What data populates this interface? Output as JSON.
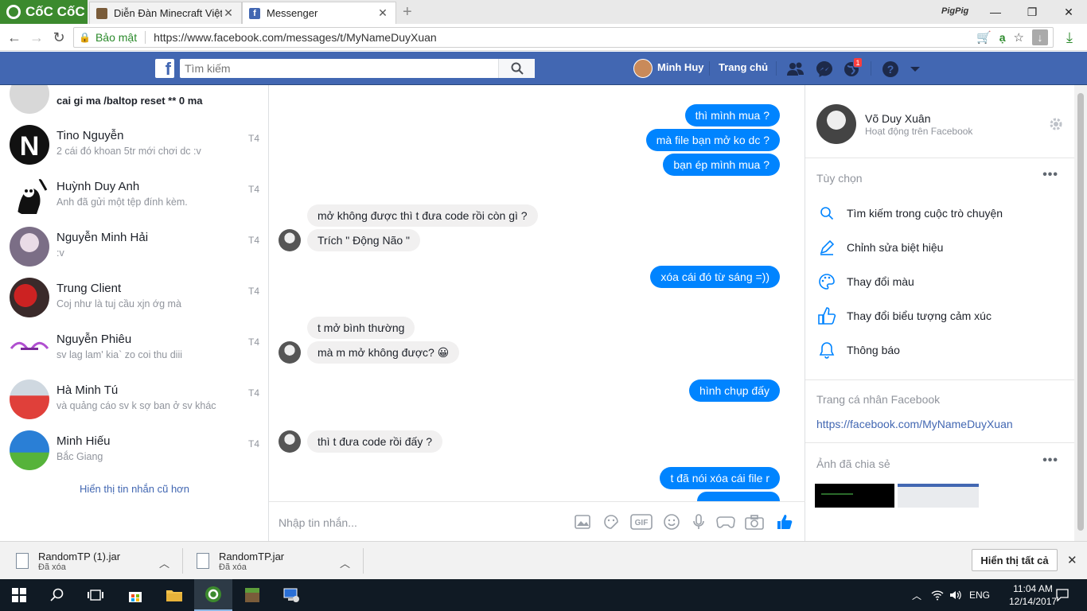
{
  "browser": {
    "brand": "CốC CốC",
    "tabs": [
      {
        "title": "Diễn Đàn Minecraft Việt N",
        "favicon": "minecraft-icon"
      },
      {
        "title": "Messenger",
        "favicon": "facebook-icon"
      }
    ],
    "profile": "PigPig",
    "security_label": "Bảo mật",
    "url": "https://www.facebook.com/messages/t/MyNameDuyXuan"
  },
  "fb": {
    "search_placeholder": "Tìm kiếm",
    "user": "Minh Huy",
    "home": "Trang chủ",
    "notif_count": "1"
  },
  "conversations": [
    {
      "name": "cai gi ma /baltop reset ** 0 ma",
      "snippet": "",
      "day": ""
    },
    {
      "name": "Tino Nguyễn",
      "snippet": "2 cái đó khoan 5tr mới chơi dc :v",
      "day": "T4"
    },
    {
      "name": "Huỳnh Duy Anh",
      "snippet": "Anh đã gửi một tệp đính kèm.",
      "day": "T4"
    },
    {
      "name": "Nguyễn Minh Hải",
      "snippet": ":v",
      "day": "T4"
    },
    {
      "name": "Trung Client",
      "snippet": "Coj như là tuj cầu xjn ớg mà",
      "day": "T4"
    },
    {
      "name": "Nguyễn Phiêu",
      "snippet": "sv lag lam' kia` zo coi thu diii",
      "day": "T4"
    },
    {
      "name": "Hà Minh Tú",
      "snippet": "và quảng cáo sv k sợ ban ở sv khác",
      "day": "T4"
    },
    {
      "name": "Minh Hiếu",
      "snippet": "Bắc Giang",
      "day": "T4"
    }
  ],
  "older_label": "Hiển thị tin nhắn cũ hơn",
  "messages": [
    {
      "text": "thì mình mua ?",
      "dir": "out"
    },
    {
      "text": "mà file bạn mở ko dc ?",
      "dir": "out"
    },
    {
      "text": "bạn ép mình mua ?",
      "dir": "out"
    },
    {
      "text": "mở không được thì t đưa code rồi còn gì ?",
      "dir": "in"
    },
    {
      "text": "Trích \" Động Não \"",
      "dir": "in"
    },
    {
      "text": "xóa cái đó từ sáng =))",
      "dir": "out"
    },
    {
      "text": "t mở bình thường",
      "dir": "in"
    },
    {
      "text": "mà m mở không được? 😀",
      "dir": "in"
    },
    {
      "text": "hình chụp đấy",
      "dir": "out"
    },
    {
      "text": "thì t đưa code rồi đấy ?",
      "dir": "in"
    },
    {
      "text": "t đã nói xóa cái file r",
      "dir": "out"
    }
  ],
  "composer_placeholder": "Nhập tin nhắn...",
  "contact": {
    "name": "Võ Duy Xuân",
    "status": "Hoạt động trên Facebook"
  },
  "options_title": "Tùy chọn",
  "options": [
    {
      "label": "Tìm kiếm trong cuộc trò chuyện",
      "icon": "search-icon"
    },
    {
      "label": "Chỉnh sửa biệt hiệu",
      "icon": "pencil-icon"
    },
    {
      "label": "Thay đổi màu",
      "icon": "palette-icon"
    },
    {
      "label": "Thay đổi biểu tượng cảm xúc",
      "icon": "thumbs-up-icon"
    },
    {
      "label": "Thông báo",
      "icon": "bell-icon"
    }
  ],
  "profile_title": "Trang cá nhân Facebook",
  "profile_link": "https://facebook.com/MyNameDuyXuan",
  "shared_title": "Ảnh đã chia sẻ",
  "downloads": [
    {
      "name": "RandomTP (1).jar",
      "status": "Đã xóa"
    },
    {
      "name": "RandomTP.jar",
      "status": "Đã xóa"
    }
  ],
  "show_all": "Hiển thị tất cả",
  "taskbar": {
    "lang": "ENG",
    "time": "11:04 AM",
    "date": "12/14/2017"
  },
  "colors": {
    "fb_blue": "#4267b2",
    "bubble_out": "#0084ff",
    "coccoc_green": "#3c8a2e"
  }
}
